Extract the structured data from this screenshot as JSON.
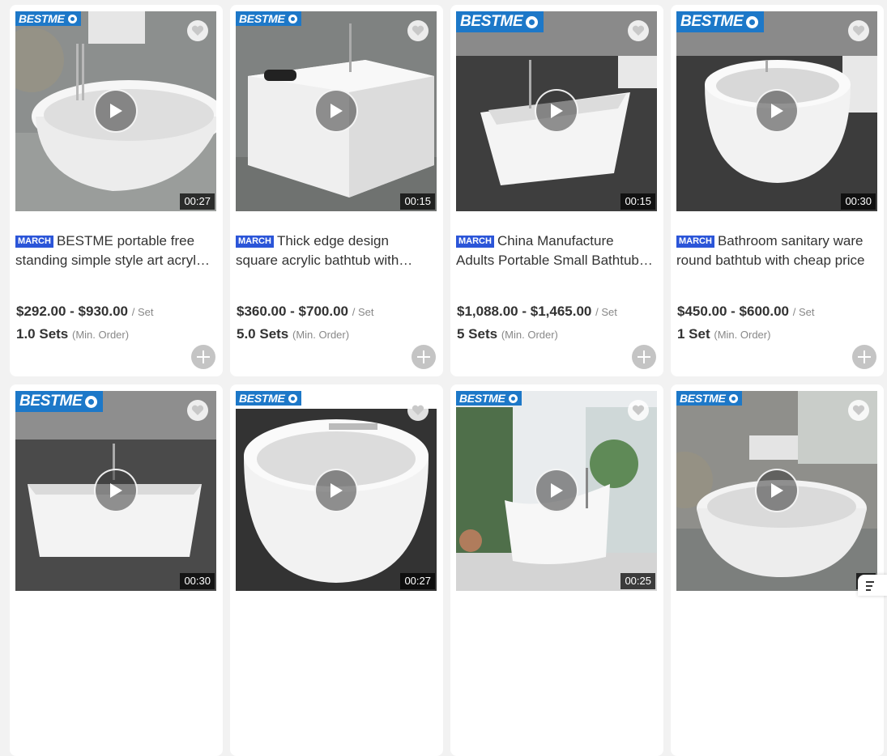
{
  "products": [
    {
      "logo": "BESTME",
      "duration": "00:27",
      "badge": "MARCH",
      "title_line1": "BESTME portable free",
      "title_line2": "standing simple style art acryl…",
      "price": "$292.00 - $930.00",
      "unit": "/ Set",
      "moq": "1.0 Sets",
      "moq_label": "(Min. Order)"
    },
    {
      "logo": "BESTME",
      "duration": "00:15",
      "badge": "MARCH",
      "title_line1": "Thick edge design",
      "title_line2": "square acrylic bathtub with…",
      "price": "$360.00 - $700.00",
      "unit": "/ Set",
      "moq": "5.0 Sets",
      "moq_label": "(Min. Order)"
    },
    {
      "logo": "BESTME",
      "duration": "00:15",
      "badge": "MARCH",
      "title_line1": "China Manufacture",
      "title_line2": "Adults Portable Small Bathtub…",
      "price": "$1,088.00 - $1,465.00",
      "unit": "/ Set",
      "moq": "5 Sets",
      "moq_label": "(Min. Order)"
    },
    {
      "logo": "BESTME",
      "duration": "00:30",
      "badge": "MARCH",
      "title_line1": "Bathroom sanitary ware",
      "title_line2": "round bathtub with cheap price",
      "price": "$450.00 - $600.00",
      "unit": "/ Set",
      "moq": "1 Set",
      "moq_label": "(Min. Order)"
    },
    {
      "logo": "BESTME",
      "duration": "00:30"
    },
    {
      "logo": "BESTME",
      "duration": "00:27"
    },
    {
      "logo": "BESTME",
      "duration": "00:25"
    },
    {
      "logo": "BESTME",
      "duration": "00"
    }
  ],
  "colors": {
    "logo_bg": "#1d78c8",
    "badge_bg": "#2b55d8"
  }
}
